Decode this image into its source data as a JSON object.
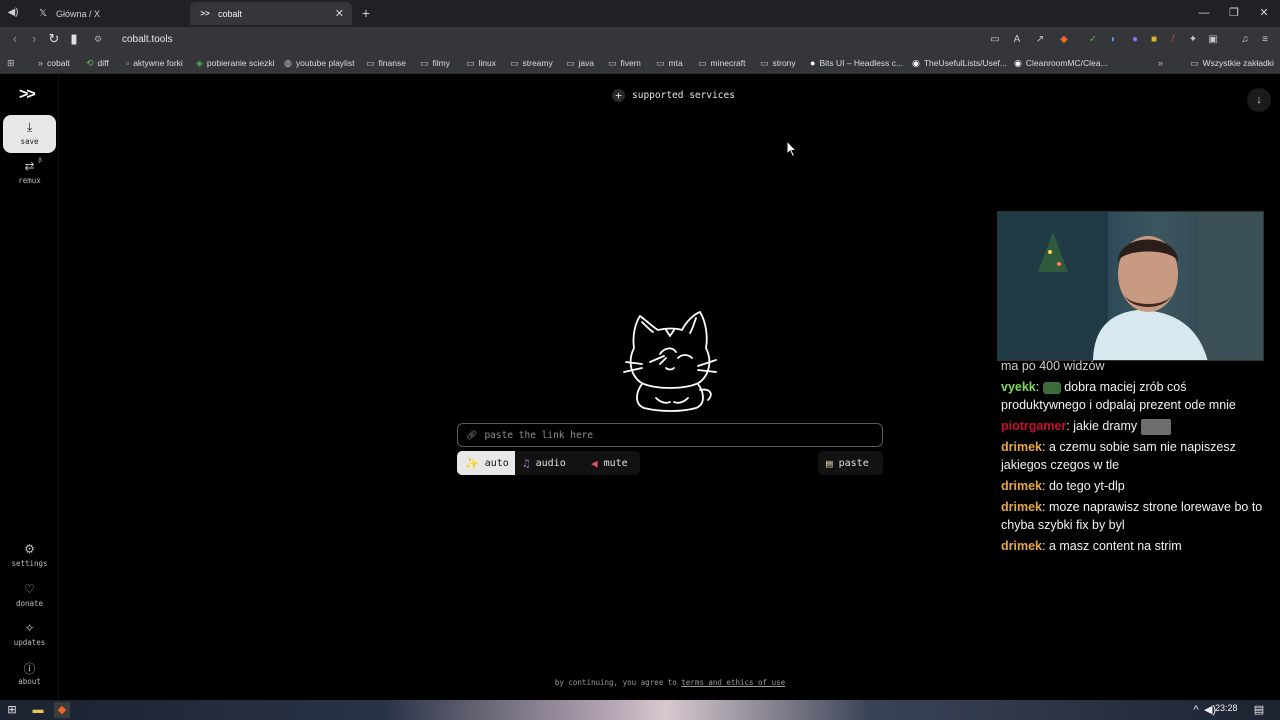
{
  "browser": {
    "tabs": [
      {
        "title": "Główna / X",
        "icon": "x-logo-icon",
        "active": false
      },
      {
        "title": "cobalt",
        "icon": "cobalt-favicon-icon",
        "active": true
      }
    ],
    "url": "cobalt.tools",
    "bookmarks": [
      {
        "label": "cobalt",
        "icon": "cobalt-favicon-icon"
      },
      {
        "label": "diff",
        "icon": "diff-icon"
      },
      {
        "label": "aktywne forki",
        "icon": "page-icon"
      },
      {
        "label": "pobieranie sciezki",
        "icon": "green-shield-icon"
      },
      {
        "label": "youtube playlist",
        "icon": "globe-icon"
      },
      {
        "label": "finanse",
        "icon": "folder-icon"
      },
      {
        "label": "filmy",
        "icon": "folder-icon"
      },
      {
        "label": "linux",
        "icon": "folder-icon"
      },
      {
        "label": "streamy",
        "icon": "folder-icon"
      },
      {
        "label": "java",
        "icon": "folder-icon"
      },
      {
        "label": "fivem",
        "icon": "folder-icon"
      },
      {
        "label": "mta",
        "icon": "folder-icon"
      },
      {
        "label": "minecraft",
        "icon": "folder-icon"
      },
      {
        "label": "strony",
        "icon": "folder-icon"
      },
      {
        "label": "Bits UI – Headless c...",
        "icon": "circle-icon"
      },
      {
        "label": "TheUsefulLists/Usef...",
        "icon": "github-icon"
      },
      {
        "label": "CleanroomMC/Clea...",
        "icon": "github-icon"
      }
    ],
    "all_bookmarks": "Wszystkie zakładki"
  },
  "app": {
    "logo": ">>",
    "nav": {
      "save": "save",
      "remux": "remux",
      "remux_badge": "β",
      "settings": "settings",
      "donate": "donate",
      "updates": "updates",
      "about": "about"
    },
    "supported_services": "supported services",
    "input_placeholder": "paste the link here",
    "modes": {
      "auto": "auto",
      "audio": "audio",
      "mute": "mute"
    },
    "selected_mode": "auto",
    "paste": "paste",
    "terms_prefix": "by continuing, you agree to",
    "terms_link": "terms and ethics of use"
  },
  "chat": {
    "partial_top": "ma po 400 widzów",
    "messages": [
      {
        "user": "vyekk",
        "color": "#7ed957",
        "text": "dobra maciej zrób coś produktywnego i odpalaj prezent ode mnie",
        "emote_before": true
      },
      {
        "user": "piotrgamer",
        "color": "#c8102e",
        "text": "jakie dramy",
        "emote_after": true
      },
      {
        "user": "drimek",
        "color": "#e8a840",
        "text": "a czemu sobie sam nie napiszesz jakiegos czegos w tle"
      },
      {
        "user": "drimek",
        "color": "#e8a840",
        "text": "do tego yt-dlp"
      },
      {
        "user": "drimek",
        "color": "#e8a840",
        "text": "moze naprawisz strone lorewave bo to chyba szybki fix by byl"
      },
      {
        "user": "drimek",
        "color": "#e8a840",
        "text": "a masz content na strim"
      }
    ]
  },
  "taskbar": {
    "time": "23:28"
  }
}
